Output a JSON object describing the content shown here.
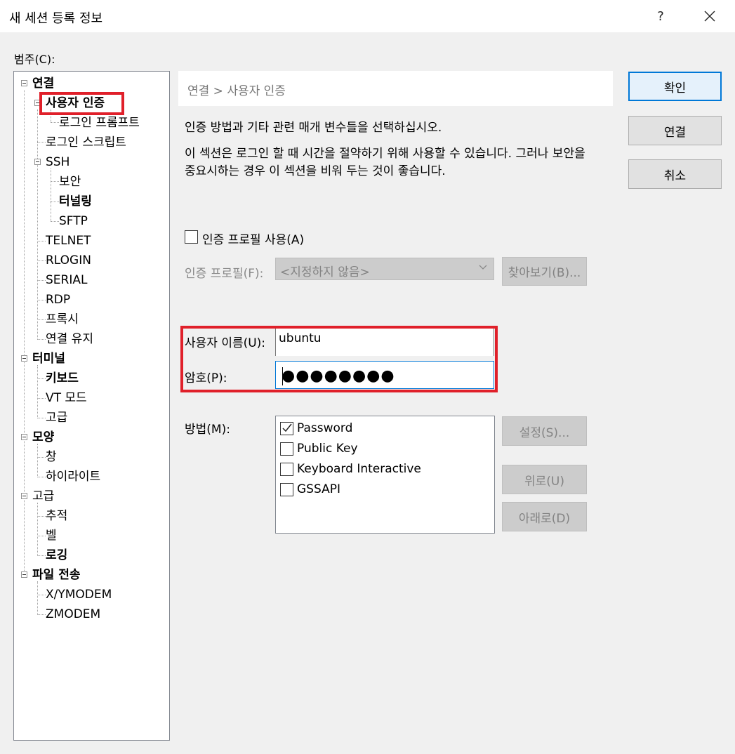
{
  "window": {
    "title": "새 세션 등록 정보",
    "help_label": "?"
  },
  "category_label": "범주(C):",
  "tree": {
    "items": [
      {
        "label": "연결",
        "bold": true
      },
      {
        "label": "사용자 인증",
        "bold": true
      },
      {
        "label": "로그인 프롬프트",
        "bold": false
      },
      {
        "label": "로그인 스크립트",
        "bold": false
      },
      {
        "label": "SSH",
        "bold": false
      },
      {
        "label": "보안",
        "bold": false
      },
      {
        "label": "터널링",
        "bold": true
      },
      {
        "label": "SFTP",
        "bold": false
      },
      {
        "label": "TELNET",
        "bold": false
      },
      {
        "label": "RLOGIN",
        "bold": false
      },
      {
        "label": "SERIAL",
        "bold": false
      },
      {
        "label": "RDP",
        "bold": false
      },
      {
        "label": "프록시",
        "bold": false
      },
      {
        "label": "연결 유지",
        "bold": false
      },
      {
        "label": "터미널",
        "bold": true
      },
      {
        "label": "키보드",
        "bold": true
      },
      {
        "label": "VT 모드",
        "bold": false
      },
      {
        "label": "고급",
        "bold": false
      },
      {
        "label": "모양",
        "bold": true
      },
      {
        "label": "창",
        "bold": false
      },
      {
        "label": "하이라이트",
        "bold": false
      },
      {
        "label": "고급",
        "bold": false
      },
      {
        "label": "추적",
        "bold": false
      },
      {
        "label": "벨",
        "bold": false
      },
      {
        "label": "로깅",
        "bold": true
      },
      {
        "label": "파일 전송",
        "bold": true
      },
      {
        "label": "X/YMODEM",
        "bold": false
      },
      {
        "label": "ZMODEM",
        "bold": false
      }
    ]
  },
  "panel": {
    "breadcrumb": "연결 > 사용자 인증",
    "description_1": "인증 방법과 기타 관련 매개 변수들을 선택하십시오.",
    "description_2": "이 섹션은 로그인 할 때 시간을 절약하기 위해 사용할 수 있습니다. 그러나 보안을 중요시하는 경우 이 섹션을 비워 두는 것이 좋습니다.",
    "use_profile_label": "인증 프로필 사용(A)",
    "use_profile_checked": false,
    "profile_label": "인증 프로필(F):",
    "profile_value": "<지정하지 않음>",
    "browse_button": "찾아보기(B)...",
    "username_label": "사용자 이름(U):",
    "username_value": "ubuntu",
    "password_label": "암호(P):",
    "password_value": "●●●●●●●●",
    "method_label": "방법(M):",
    "methods": [
      {
        "label": "Password",
        "checked": true
      },
      {
        "label": "Public Key",
        "checked": false
      },
      {
        "label": "Keyboard Interactive",
        "checked": false
      },
      {
        "label": "GSSAPI",
        "checked": false
      }
    ],
    "settings_button": "설정(S)...",
    "up_button": "위로(U)",
    "down_button": "아래로(D)"
  },
  "buttons": {
    "ok": "확인",
    "connect": "연결",
    "cancel": "취소"
  },
  "colors": {
    "highlight_box": "#e0202a",
    "focus_border": "#0078d7"
  }
}
